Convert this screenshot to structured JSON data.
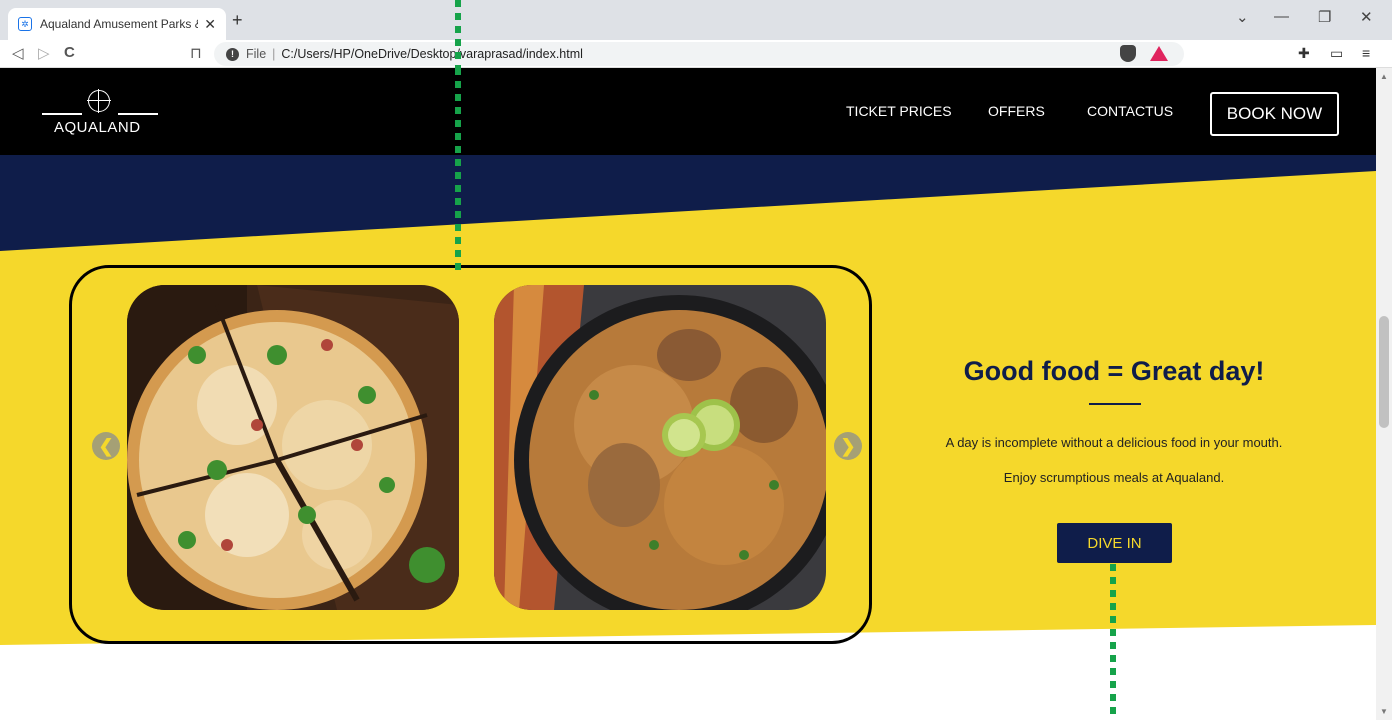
{
  "browser": {
    "tab_title": "Aqualand Amusement Parks & Re",
    "tab_close": "✕",
    "new_tab": "+",
    "nav": {
      "back": "◁",
      "forward": "▷",
      "reload": "C",
      "bookmark": "⊓"
    },
    "url_scheme": "File",
    "url_separator": "|",
    "url": "C:/Users/HP/OneDrive/Desktop/varaprasad/index.html",
    "window": {
      "dropdown": "⌄",
      "minimize": "—",
      "restore": "❐",
      "close": "✕"
    },
    "extensions": {
      "puzzle": "✚",
      "wallet": "▭",
      "menu": "≡"
    }
  },
  "site": {
    "logo_text": "AQUALAND",
    "nav": {
      "ticket_prices": "TICKET PRICES",
      "offers": "OFFERS",
      "contact": "CONTACTUS",
      "book_now": "BOOK NOW"
    },
    "colors": {
      "navy": "#0f1d4a",
      "yellow": "#f5d82b",
      "black": "#000000"
    }
  },
  "carousel": {
    "prev": "❮",
    "next": "❯",
    "slides": [
      "pizza",
      "chicken-biryani"
    ]
  },
  "food": {
    "title": "Good food = Great day!",
    "line1": "A day is incomplete without a delicious food in your mouth.",
    "line2": "Enjoy scrumptious meals at Aqualand.",
    "button": "DIVE IN"
  },
  "scroll": {
    "up": "▲",
    "down": "▼"
  }
}
